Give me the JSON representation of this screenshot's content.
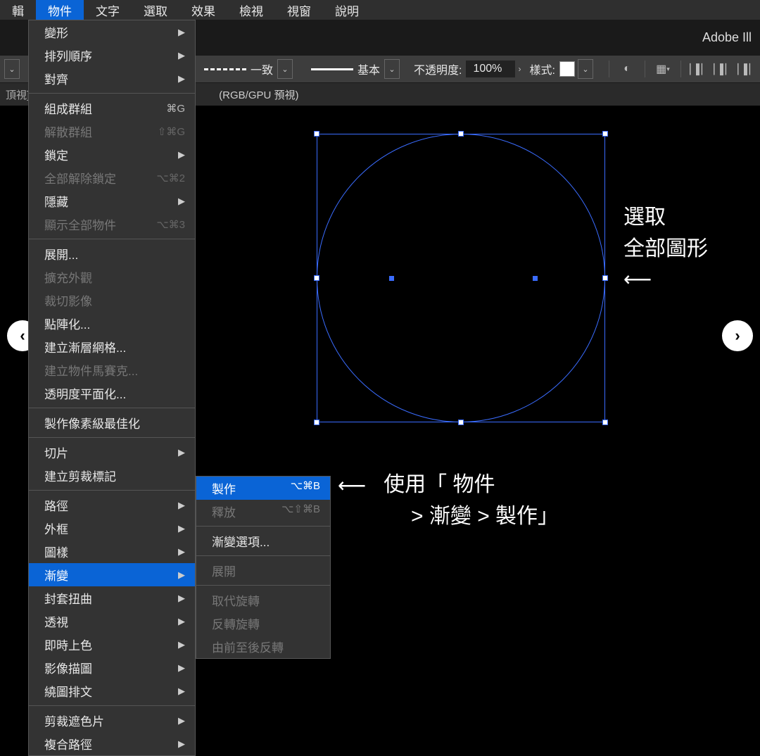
{
  "app_brand": "Adobe Ill",
  "menubar": {
    "items": [
      "輯",
      "物件",
      "文字",
      "選取",
      "效果",
      "檢視",
      "視窗",
      "說明"
    ],
    "active_index": 1
  },
  "optbar": {
    "stroke_style_label": "一致",
    "brush_label": "基本",
    "opacity_label": "不透明度:",
    "opacity_value": "100%",
    "style_label": "樣式:"
  },
  "tabbar": {
    "edge_label": "頂視]",
    "doc_info": "(RGB/GPU 預視)"
  },
  "menu": {
    "sections": [
      [
        {
          "label": "變形",
          "arrow": true
        },
        {
          "label": "排列順序",
          "arrow": true
        },
        {
          "label": "對齊",
          "arrow": true
        }
      ],
      [
        {
          "label": "組成群組",
          "shortcut": "⌘G"
        },
        {
          "label": "解散群組",
          "shortcut": "⇧⌘G",
          "disabled": true
        },
        {
          "label": "鎖定",
          "arrow": true
        },
        {
          "label": "全部解除鎖定",
          "shortcut": "⌥⌘2",
          "disabled": true
        },
        {
          "label": "隱藏",
          "arrow": true
        },
        {
          "label": "顯示全部物件",
          "shortcut": "⌥⌘3",
          "disabled": true
        }
      ],
      [
        {
          "label": "展開..."
        },
        {
          "label": "擴充外觀",
          "disabled": true
        },
        {
          "label": "裁切影像",
          "disabled": true
        },
        {
          "label": "點陣化..."
        },
        {
          "label": "建立漸層網格..."
        },
        {
          "label": "建立物件馬賽克...",
          "disabled": true
        },
        {
          "label": "透明度平面化..."
        }
      ],
      [
        {
          "label": "製作像素級最佳化"
        }
      ],
      [
        {
          "label": "切片",
          "arrow": true
        },
        {
          "label": "建立剪裁標記"
        }
      ],
      [
        {
          "label": "路徑",
          "arrow": true
        },
        {
          "label": "外框",
          "arrow": true
        },
        {
          "label": "圖樣",
          "arrow": true
        },
        {
          "label": "漸變",
          "arrow": true,
          "hi": true
        },
        {
          "label": "封套扭曲",
          "arrow": true
        },
        {
          "label": "透視",
          "arrow": true
        },
        {
          "label": "即時上色",
          "arrow": true
        },
        {
          "label": "影像描圖",
          "arrow": true
        },
        {
          "label": "繞圖排文",
          "arrow": true
        }
      ],
      [
        {
          "label": "剪裁遮色片",
          "arrow": true
        },
        {
          "label": "複合路徑",
          "arrow": true
        }
      ]
    ]
  },
  "submenu": {
    "items": [
      {
        "label": "製作",
        "shortcut": "⌥⌘B",
        "hi": true
      },
      {
        "label": "釋放",
        "shortcut": "⌥⇧⌘B",
        "disabled": true
      },
      {
        "sep": true
      },
      {
        "label": "漸變選項..."
      },
      {
        "sep": true
      },
      {
        "label": "展開",
        "disabled": true
      },
      {
        "sep": true
      },
      {
        "label": "取代旋轉",
        "disabled": true
      },
      {
        "label": "反轉旋轉",
        "disabled": true
      },
      {
        "label": "由前至後反轉",
        "disabled": true
      }
    ]
  },
  "annotations": {
    "a1_l1": "選取",
    "a1_l2": "全部圖形",
    "a1_arrow": "⟵",
    "a2_arrow": "⟵",
    "a2_l1": "使用「 物件",
    "a2_l2": " > 漸變 > 製作」"
  }
}
